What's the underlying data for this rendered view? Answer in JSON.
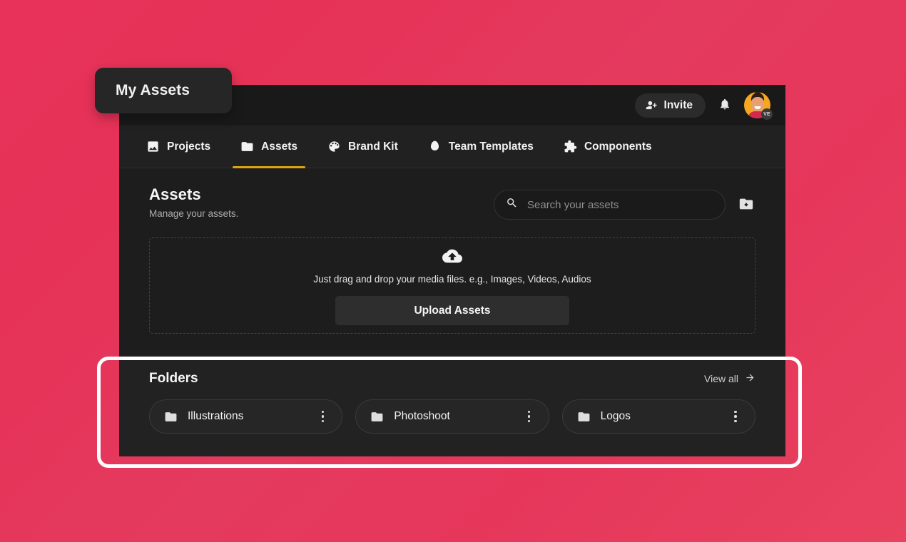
{
  "tooltip": {
    "label": "My Assets"
  },
  "topbar": {
    "invite_label": "Invite",
    "invite_icon": "user-plus-icon",
    "notifications_icon": "bell-icon",
    "avatar_badge": "VE"
  },
  "tabs": [
    {
      "label": "Projects",
      "icon": "image-icon",
      "active": false
    },
    {
      "label": "Assets",
      "icon": "folder-icon",
      "active": true
    },
    {
      "label": "Brand Kit",
      "icon": "palette-icon",
      "active": false
    },
    {
      "label": "Team Templates",
      "icon": "egg-icon",
      "active": false
    },
    {
      "label": "Components",
      "icon": "puzzle-piece-icon",
      "active": false
    }
  ],
  "page": {
    "title": "Assets",
    "subtitle": "Manage your assets."
  },
  "search": {
    "placeholder": "Search your assets",
    "value": "",
    "icon": "search-icon"
  },
  "new_folder": {
    "icon": "folder-plus-icon"
  },
  "dropzone": {
    "icon": "cloud-upload-icon",
    "text": "Just drag and drop your media files. e.g., Images, Videos, Audios",
    "button_label": "Upload Assets"
  },
  "folders": {
    "title": "Folders",
    "view_all_label": "View all",
    "view_all_icon": "arrow-right-icon",
    "items": [
      {
        "name": "Illustrations",
        "icon": "folder-icon"
      },
      {
        "name": "Photoshoot",
        "icon": "folder-icon"
      },
      {
        "name": "Logos",
        "icon": "folder-icon"
      }
    ]
  },
  "colors": {
    "background_pink": "#e6325a",
    "panel_dark": "#1d1d1d",
    "panel_darker": "#191919",
    "tabbar": "#212121",
    "folders_panel": "#222222",
    "active_tab_underline": "#d9a417",
    "highlight_ring": "#ffffff",
    "avatar_bg": "#f5a623"
  }
}
